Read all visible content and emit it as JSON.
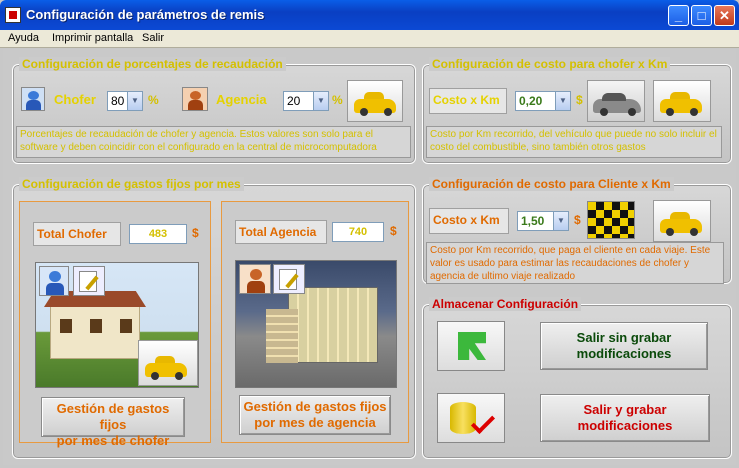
{
  "window": {
    "title": "Configuración de parámetros de remis",
    "min": "_",
    "max": "□",
    "close": "✕"
  },
  "menu": [
    "Ayuda",
    "Imprimir pantalla",
    "Salir"
  ],
  "recaudacion": {
    "title": "Configuración de porcentajes de recaudación",
    "chofer_label": "Chofer",
    "chofer_value": "80",
    "pct1": "%",
    "agencia_label": "Agencia",
    "agencia_value": "20",
    "pct2": "%",
    "desc": "Porcentajes de recaudación de chofer y agencia. Estos valores son solo para el software y deben coincidir con el configurado en la central de microcomputadora"
  },
  "costo_chofer": {
    "title": "Configuración de costo para chofer x Km",
    "label": "Costo x Km",
    "value": "0,20",
    "currency": "$",
    "desc": "Costo por Km recorrido, del vehículo que puede no solo incluir el costo del combustible, sino también otros gastos"
  },
  "gastos": {
    "title": "Configuración de gastos fijos por mes",
    "total_chofer_label": "Total Chofer",
    "total_chofer_value": "483",
    "cur1": "$",
    "total_agencia_label": "Total Agencia",
    "total_agencia_value": "740",
    "cur2": "$",
    "btn_chofer_1": "Gestión de gastos fijos",
    "btn_chofer_2": "por mes de chofer",
    "btn_agencia_1": "Gestión de gastos fijos",
    "btn_agencia_2": "por mes de agencia"
  },
  "costo_cliente": {
    "title": "Configuración de costo para Cliente x Km",
    "label": "Costo x Km",
    "value": "1,50",
    "currency": "$",
    "desc": "Costo por Km recorrido, que paga el cliente en cada viaje. Este valor es usado para estimar las recaudaciones de chofer y agencia de ultimo viaje realizado"
  },
  "almacenar": {
    "title": "Almacenar Configuración",
    "salir_sin_1": "Salir sin grabar",
    "salir_sin_2": "modificaciones",
    "salir_con_1": "Salir y grabar",
    "salir_con_2": "modificaciones"
  },
  "colors": {
    "accent_yellow": "#e5d200",
    "accent_orange": "#e06a00",
    "green_text": "#0a5a0a",
    "red_text": "#cc0000"
  }
}
